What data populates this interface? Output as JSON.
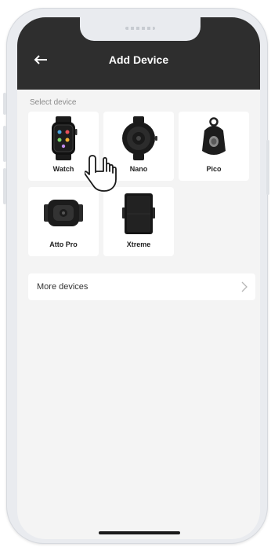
{
  "header": {
    "title": "Add Device"
  },
  "section": {
    "label": "Select device"
  },
  "devices": [
    {
      "label": "Watch",
      "icon": "smartwatch-icon"
    },
    {
      "label": "Nano",
      "icon": "nano-tracker-icon"
    },
    {
      "label": "Pico",
      "icon": "pico-tracker-icon"
    },
    {
      "label": "Atto Pro",
      "icon": "atto-pro-tracker-icon"
    },
    {
      "label": "Xtreme",
      "icon": "xtreme-tracker-icon"
    }
  ],
  "more": {
    "label": "More devices"
  },
  "colors": {
    "header_bg": "#2e2e2e",
    "screen_bg": "#f4f4f4",
    "card_bg": "#ffffff"
  }
}
